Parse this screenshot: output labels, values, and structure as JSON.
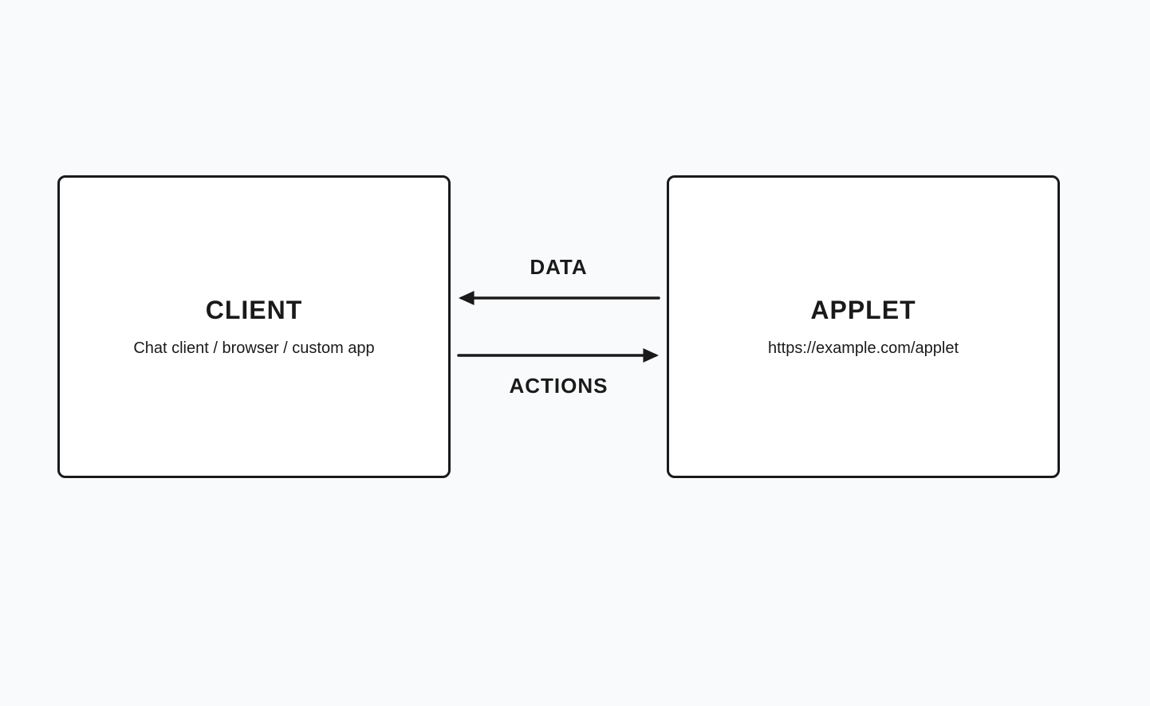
{
  "client": {
    "title": "CLIENT",
    "subtitle": "Chat client / browser / custom app"
  },
  "applet": {
    "title": "APPLET",
    "subtitle": "https://example.com/applet"
  },
  "arrows": {
    "top_label": "DATA",
    "bottom_label": "ACTIONS"
  }
}
